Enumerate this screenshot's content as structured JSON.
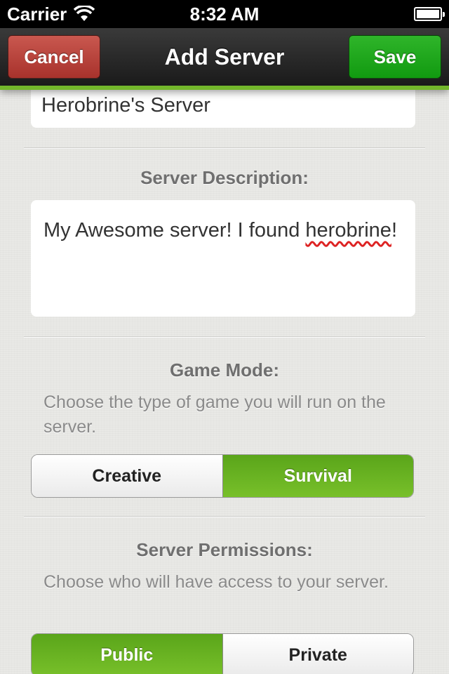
{
  "status_bar": {
    "carrier": "Carrier",
    "time": "8:32 AM"
  },
  "nav": {
    "title": "Add Server",
    "cancel_label": "Cancel",
    "save_label": "Save",
    "accent_color": "#73b72b"
  },
  "form": {
    "server_name_value": "Herobrine's Server",
    "description": {
      "label": "Server Description:",
      "value_part1": "My Awesome server! I found ",
      "value_misspelled": "herobrine",
      "value_part2": "!"
    },
    "game_mode": {
      "label": "Game Mode:",
      "hint": "Choose the type of game you will run on the server.",
      "options": [
        "Creative",
        "Survival"
      ],
      "selected": "Survival"
    },
    "permissions": {
      "label": "Server Permissions:",
      "hint": "Choose who will have access to your server.",
      "options": [
        "Public",
        "Private"
      ],
      "selected": "Public"
    }
  }
}
